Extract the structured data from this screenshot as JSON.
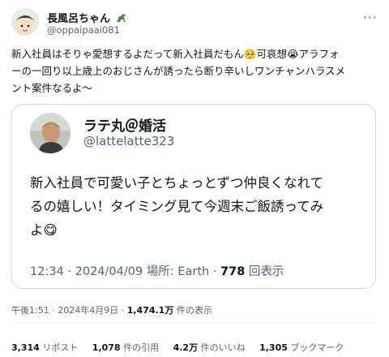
{
  "tweet": {
    "author_name": "長風呂ちゃん",
    "author_handle": "@oppaipaai081",
    "more_label": "···",
    "text_lines": [
      "新入社員はそりゃ愛想するよだって新入社員だもん🥺可哀想😭アラフォ",
      "ーの一回り以上歳上のおじさんが誘ったら断り辛いしワンチャンハラスメ",
      "ント案件なるよ～"
    ],
    "time": "午後1:51",
    "date": "2024年4月9日",
    "views_count": "1,474.1万",
    "views_label": "件の表示"
  },
  "quoted": {
    "author_name": "ラテ丸＠婚活",
    "author_handle": "@lattelatte323",
    "text_lines": [
      "新入社員で可愛い子とちょっとずつ仲良くなれて",
      "るの嬉しい！タイミング見て今週末ご飯誘ってみ",
      "よ😋"
    ],
    "time": "12:34",
    "date": "2024/04/09",
    "place_label": "場所: Earth",
    "views_count": "778",
    "views_label": "回表示"
  },
  "stats": {
    "retweets_count": "3,314",
    "retweets_label": "リポスト",
    "quotes_count": "1,078",
    "quotes_label": "件の引用",
    "likes_count": "4.2万",
    "likes_label": "件のいいね",
    "bookmarks_count": "1,305",
    "bookmarks_label": "ブックマーク"
  },
  "icons": {
    "author_badge": "dinosaur-icon",
    "more": "more-icon"
  }
}
